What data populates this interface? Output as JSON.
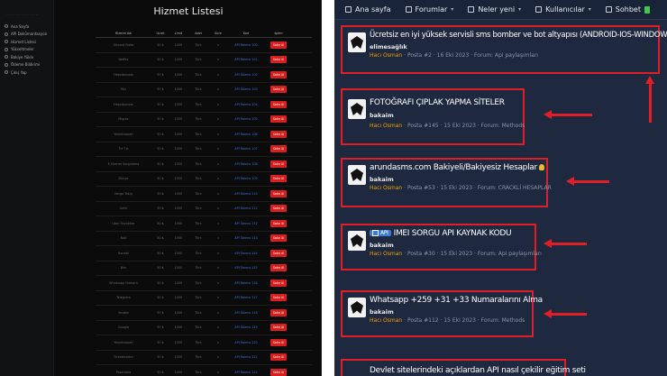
{
  "left": {
    "title": "Hizmet Listesi",
    "sidebar": [
      {
        "label": "Ana Sayfa",
        "icon": "home-icon"
      },
      {
        "label": "API Dokümantasyon",
        "icon": "doc-icon"
      },
      {
        "label": "Hizmet Listesi",
        "icon": "list-icon"
      },
      {
        "label": "Yükseltmeler",
        "icon": "upgrade-icon"
      },
      {
        "label": "Bakiye Yükle",
        "icon": "wallet-icon"
      },
      {
        "label": "Ödeme Bildirimi",
        "icon": "payment-icon"
      },
      {
        "label": "Çıkış Yap",
        "icon": "logout-icon"
      }
    ],
    "columns": [
      "Hizmet Adı",
      "Ücret",
      "Limit",
      "Adet",
      "Süre",
      "Kod",
      "İşlem"
    ],
    "rows": [
      {
        "name": "Discord Roles",
        "price": "50 ₺",
        "limit": "1000",
        "count": "Türk",
        "time": "∞",
        "code": "API Tokens 100",
        "buy": "Satın Al"
      },
      {
        "name": "Netflix",
        "price": "50 ₺",
        "limit": "1000",
        "count": "Türk",
        "time": "∞",
        "code": "API Tokens 101",
        "buy": "Satın Al"
      },
      {
        "name": "Hepsiburada",
        "price": "50 ₺",
        "limit": "1000",
        "count": "Türk",
        "time": "∞",
        "code": "API Tokens 102",
        "buy": "Satın Al"
      },
      {
        "name": "Blu",
        "price": "50 ₺",
        "limit": "1000",
        "count": "Türk",
        "time": "∞",
        "code": "API Tokens 103",
        "buy": "Satın Al"
      },
      {
        "name": "Hepsiburada",
        "price": "50 ₺",
        "limit": "1000",
        "count": "Türk",
        "time": "∞",
        "code": "API Tokens 104",
        "buy": "Satın Al"
      },
      {
        "name": "Migros",
        "price": "50 ₺",
        "limit": "1000",
        "count": "Türk",
        "time": "∞",
        "code": "API Tokens 105",
        "buy": "Satın Al"
      },
      {
        "name": "Yemeksepeti",
        "price": "50 ₺",
        "limit": "1000",
        "count": "Türk",
        "time": "∞",
        "code": "API Tokens 106",
        "buy": "Satın Al"
      },
      {
        "name": "Tık Tık",
        "price": "50 ₺",
        "limit": "1000",
        "count": "Türk",
        "time": "∞",
        "code": "API Tokens 107",
        "buy": "Satın Al"
      },
      {
        "name": "E-Hizmet Sorgulama",
        "price": "50 ₺",
        "limit": "1000",
        "count": "Türk",
        "time": "∞",
        "code": "API Tokens 108",
        "buy": "Satın Al"
      },
      {
        "name": "Dünya",
        "price": "50 ₺",
        "limit": "1000",
        "count": "Türk",
        "time": "∞",
        "code": "API Tokens 109",
        "buy": "Satın Al"
      },
      {
        "name": "Kargo Takip",
        "price": "50 ₺",
        "limit": "1000",
        "count": "Türk",
        "time": "∞",
        "code": "API Tokens 110",
        "buy": "Satın Al"
      },
      {
        "name": "Getir",
        "price": "50 ₺",
        "limit": "1000",
        "count": "Türk",
        "time": "∞",
        "code": "API Tokens 111",
        "buy": "Satın Al"
      },
      {
        "name": "Uber Marketler",
        "price": "50 ₺",
        "limit": "1000",
        "count": "Türk",
        "time": "∞",
        "code": "API Tokens 112",
        "buy": "Satın Al"
      },
      {
        "name": "Bolt",
        "price": "50 ₺",
        "limit": "1000",
        "count": "Türk",
        "time": "∞",
        "code": "API Tokens 113",
        "buy": "Satın Al"
      },
      {
        "name": "Banabi",
        "price": "50 ₺",
        "limit": "1000",
        "count": "Türk",
        "time": "∞",
        "code": "API Tokens 114",
        "buy": "Satın Al"
      },
      {
        "name": "Bim",
        "price": "50 ₺",
        "limit": "1000",
        "count": "Türk",
        "time": "∞",
        "code": "API Tokens 115",
        "buy": "Satın Al"
      },
      {
        "name": "Whatsapp Numara",
        "price": "50 ₺",
        "limit": "1000",
        "count": "Türk",
        "time": "∞",
        "code": "API Tokens 116",
        "buy": "Satın Al"
      },
      {
        "name": "Telegram",
        "price": "50 ₺",
        "limit": "1000",
        "count": "Türk",
        "time": "∞",
        "code": "API Tokens 117",
        "buy": "Satın Al"
      },
      {
        "name": "Yandex",
        "price": "50 ₺",
        "limit": "1000",
        "count": "Türk",
        "time": "∞",
        "code": "API Tokens 118",
        "buy": "Satın Al"
      },
      {
        "name": "Google",
        "price": "50 ₺",
        "limit": "1000",
        "count": "Türk",
        "time": "∞",
        "code": "API Tokens 119",
        "buy": "Satın Al"
      },
      {
        "name": "Yemeksepeti",
        "price": "50 ₺",
        "limit": "1000",
        "count": "Türk",
        "time": "∞",
        "code": "API Tokens 120",
        "buy": "Satın Al"
      },
      {
        "name": "Ticketmaster",
        "price": "50 ₺",
        "limit": "1000",
        "count": "Türk",
        "time": "∞",
        "code": "API Tokens 121",
        "buy": "Satın Al"
      },
      {
        "name": "Pazarama",
        "price": "50 ₺",
        "limit": "1000",
        "count": "Türk",
        "time": "∞",
        "code": "API Tokens 122",
        "buy": "Satın Al"
      }
    ]
  },
  "right": {
    "nav": [
      {
        "label": "Ana sayfa",
        "icon": "home-icon"
      },
      {
        "label": "Forumlar",
        "icon": "forum-icon"
      },
      {
        "label": "Neler yeni",
        "icon": "new-icon"
      },
      {
        "label": "Kullanıcılar",
        "icon": "users-icon"
      },
      {
        "label": "Sohbet",
        "icon": "plus-icon"
      }
    ],
    "threads": [
      {
        "title": "Ücretsiz en iyi yüksek servisli sms bomber ve bot altyapısı (ANDROID-IOS-WINDOWS)",
        "author": "elimesağlık",
        "user": "Hacı Osman",
        "meta": " · Posta #2 · 16 Eki 2023 · Forum: Api paylaşımları"
      },
      {
        "title": "FOTOĞRAFI ÇIPLAK YAPMA SİTELER",
        "author": "bakaim",
        "user": "Hacı Osman",
        "meta": " · Posta #145 · 15 Eki 2023 · Forum: Methods"
      },
      {
        "title": "arundasms.com Bakiyeli/Bakiyesiz Hesaplar",
        "author": "bakaim",
        "user": "Hacı Osman",
        "meta": " · Posta #53 · 15 Eki 2023 · Forum: CRACKLİ HESAPLAR"
      },
      {
        "title": "IMEI SORGU API KAYNAK KODU",
        "badge": "API",
        "author": "bakaim",
        "user": "Hacı Osman",
        "meta": " · Posta #30 · 15 Eki 2023 · Forum: Api paylaşımları"
      },
      {
        "title": "Whatsapp +259 +31 +33 Numaralarını Alma",
        "author": "bakaim",
        "user": "Hacı Osman",
        "meta": " · Posta #112 · 15 Eki 2023 · Forum: Methods"
      },
      {
        "title": "Devlet sitelerindeki açıklardan API nasıl çekilir eğitim seti",
        "author": "",
        "user": "",
        "meta": ""
      }
    ]
  }
}
